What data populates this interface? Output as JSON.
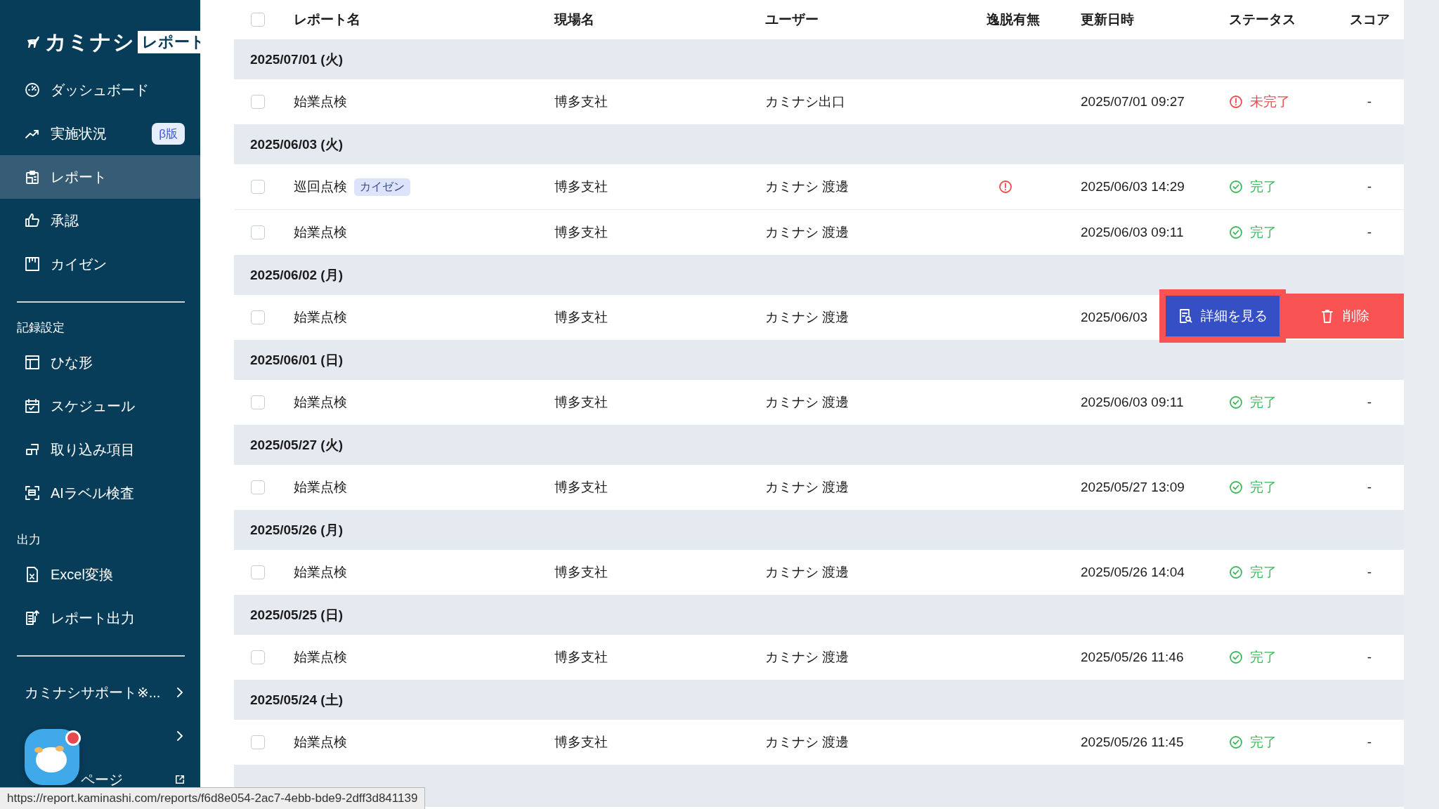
{
  "sidebar": {
    "logo": {
      "name": "カミナシ",
      "badge": "レポート"
    },
    "sections": [
      {
        "items": [
          {
            "label": "ダッシュボード",
            "selected": false
          },
          {
            "label": "実施状況",
            "badge": "β版",
            "selected": false
          },
          {
            "label": "レポート",
            "selected": true
          },
          {
            "label": "承認",
            "selected": false
          },
          {
            "label": "カイゼン",
            "selected": false
          }
        ]
      },
      {
        "heading": "記録設定",
        "items": [
          {
            "label": "ひな形",
            "selected": false
          },
          {
            "label": "スケジュール",
            "selected": false
          },
          {
            "label": "取り込み項目",
            "selected": false
          },
          {
            "label": "AIラベル検査",
            "selected": false
          }
        ]
      },
      {
        "heading": "出力",
        "items": [
          {
            "label": "Excel変換",
            "selected": false
          },
          {
            "label": "レポート出力",
            "selected": false
          }
        ]
      }
    ],
    "footer": [
      {
        "label": "カミナシサポート※...",
        "kind": "submenu"
      },
      {
        "kind": "submenu"
      },
      {
        "label": "ページ",
        "kind": "external"
      }
    ]
  },
  "table": {
    "select_all_checked": false,
    "columns": [
      "レポート名",
      "現場名",
      "ユーザー",
      "逸脱有無",
      "更新日時",
      "ステータス",
      "スコア"
    ],
    "groups": [
      {
        "date": "2025/07/01 (火)",
        "rows": [
          {
            "checked": false,
            "name": "始業点検",
            "site": "博多支社",
            "user": "カミナシ出口",
            "deviation": false,
            "updated": "2025/07/01 09:27",
            "status": {
              "kind": "incomplete",
              "label": "未完了"
            },
            "score": "-"
          }
        ]
      },
      {
        "date": "2025/06/03 (火)",
        "rows": [
          {
            "checked": false,
            "name": "巡回点検",
            "tag": "カイゼン",
            "site": "博多支社",
            "user": "カミナシ 渡邊",
            "deviation": true,
            "updated": "2025/06/03 14:29",
            "status": {
              "kind": "complete",
              "label": "完了"
            },
            "score": "-"
          },
          {
            "checked": false,
            "name": "始業点検",
            "site": "博多支社",
            "user": "カミナシ 渡邊",
            "deviation": false,
            "updated": "2025/06/03 09:11",
            "status": {
              "kind": "complete",
              "label": "完了"
            },
            "score": "-"
          }
        ]
      },
      {
        "date": "2025/06/02 (月)",
        "rows": [
          {
            "checked": false,
            "name": "始業点検",
            "site": "博多支社",
            "user": "カミナシ 渡邊",
            "deviation": false,
            "updated": "2025/06/03",
            "actions": [
              {
                "kind": "detail",
                "label": "詳細を見る",
                "focused": true
              },
              {
                "kind": "delete",
                "label": "削除",
                "focused": false
              }
            ]
          }
        ]
      },
      {
        "date": "2025/06/01 (日)",
        "rows": [
          {
            "checked": false,
            "name": "始業点検",
            "site": "博多支社",
            "user": "カミナシ 渡邊",
            "deviation": false,
            "updated": "2025/06/03 09:11",
            "status": {
              "kind": "complete",
              "label": "完了"
            },
            "score": "-"
          }
        ]
      },
      {
        "date": "2025/05/27 (火)",
        "rows": [
          {
            "checked": false,
            "name": "始業点検",
            "site": "博多支社",
            "user": "カミナシ 渡邊",
            "deviation": false,
            "updated": "2025/05/27 13:09",
            "status": {
              "kind": "complete",
              "label": "完了"
            },
            "score": "-"
          }
        ]
      },
      {
        "date": "2025/05/26 (月)",
        "rows": [
          {
            "checked": false,
            "name": "始業点検",
            "site": "博多支社",
            "user": "カミナシ 渡邊",
            "deviation": false,
            "updated": "2025/05/26 14:04",
            "status": {
              "kind": "complete",
              "label": "完了"
            },
            "score": "-"
          }
        ]
      },
      {
        "date": "2025/05/25 (日)",
        "rows": [
          {
            "checked": false,
            "name": "始業点検",
            "site": "博多支社",
            "user": "カミナシ 渡邊",
            "deviation": false,
            "updated": "2025/05/26 11:46",
            "status": {
              "kind": "complete",
              "label": "完了"
            },
            "score": "-"
          }
        ]
      },
      {
        "date": "2025/05/24 (土)",
        "rows": [
          {
            "checked": false,
            "name": "始業点検",
            "site": "博多支社",
            "user": "カミナシ 渡邊",
            "deviation": false,
            "updated": "2025/05/26 11:45",
            "status": {
              "kind": "complete",
              "label": "完了"
            },
            "score": "-"
          }
        ]
      }
    ]
  },
  "chat_widget": {
    "notification": true
  },
  "status_bar": {
    "url": "https://report.kaminashi.com/reports/f6d8e054-2ac7-4ebb-bde9-2dff3d841139"
  }
}
